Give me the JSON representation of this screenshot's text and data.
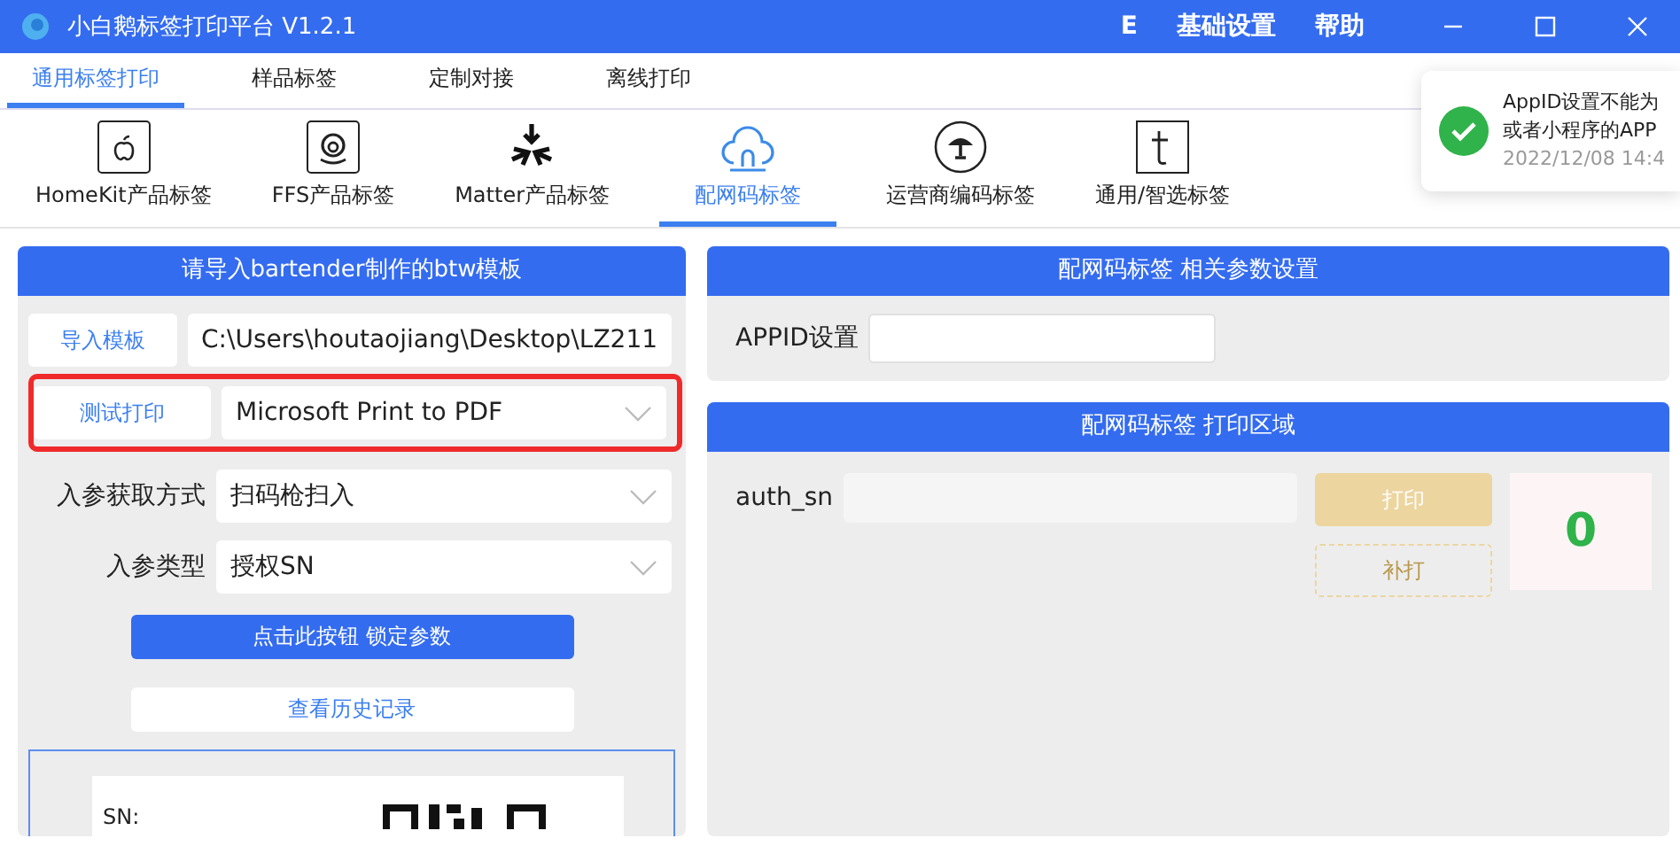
{
  "window": {
    "title": "小白鹅标签打印平台 V1.2.1",
    "menu": [
      "E",
      "基础设置",
      "帮助"
    ]
  },
  "tabs": [
    {
      "label": "通用标签打印",
      "selected": true
    },
    {
      "label": "样品标签",
      "selected": false
    },
    {
      "label": "定制对接",
      "selected": false
    },
    {
      "label": "离线打印",
      "selected": false
    }
  ],
  "label_types": [
    {
      "label": "HomeKit产品标签",
      "kind": "apple",
      "selected": false
    },
    {
      "label": "FFS产品标签",
      "kind": "amazon",
      "selected": false
    },
    {
      "label": "Matter产品标签",
      "kind": "matter",
      "selected": false
    },
    {
      "label": "配网码标签",
      "kind": "cloud",
      "selected": true
    },
    {
      "label": "运营商编码标签",
      "kind": "fan",
      "selected": false
    },
    {
      "label": "通用/智选标签",
      "kind": "letter",
      "selected": false
    }
  ],
  "template_panel": {
    "title": "请导入bartender制作的btw模板",
    "import_button": "导入模板",
    "template_path": "C:\\Users\\houtaojiang\\Desktop\\LZ211",
    "test_print_button": "测试打印",
    "printer": "Microsoft Print to PDF",
    "printer_highlighted": true,
    "rows": [
      {
        "label": "入参获取方式",
        "value": "扫码枪扫入"
      },
      {
        "label": "入参类型",
        "value": "授权SN"
      }
    ],
    "lock_button": "点击此按钮 锁定参数",
    "history_button": "查看历史记录",
    "preview": {
      "sn_label": "SN:"
    }
  },
  "settings_panel": {
    "title": "配网码标签 相关参数设置",
    "appid_label": "APPID设置"
  },
  "print_panel": {
    "title": "配网码标签 打印区域",
    "field_label": "auth_sn",
    "print_button": {
      "label": "打印",
      "disabled": true
    },
    "reprint_button": {
      "label": "补打",
      "disabled": true
    },
    "counter": "0"
  },
  "toast": {
    "lines": [
      "AppID设置不能为",
      "或者小程序的APP"
    ],
    "time": "2022/12/08 14:4"
  }
}
